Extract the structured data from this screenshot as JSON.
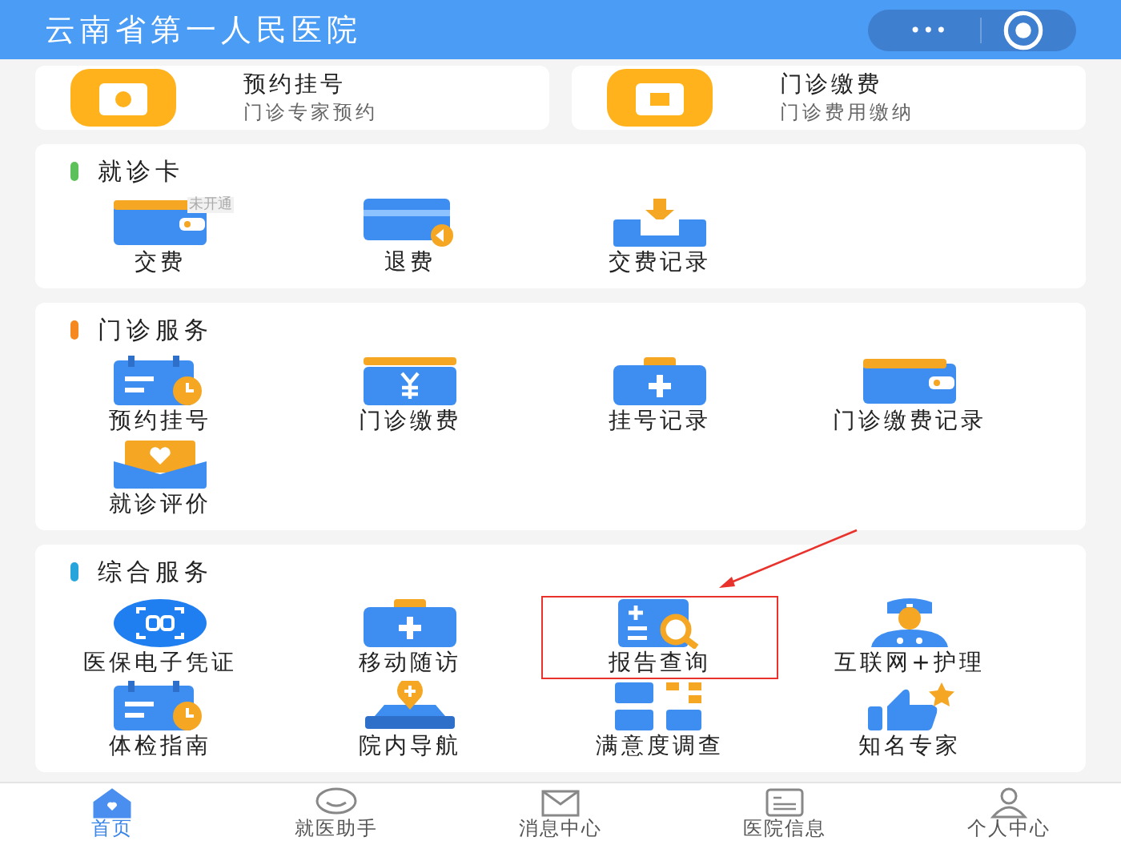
{
  "header": {
    "title": "云南省第一人民医院",
    "menu_dots": "•••"
  },
  "top_cards": [
    {
      "title": "预约挂号",
      "subtitle": "门诊专家预约"
    },
    {
      "title": "门诊缴费",
      "subtitle": "门诊费用缴纳"
    }
  ],
  "sections": [
    {
      "title": "就诊卡",
      "color": "#5cc15a",
      "items": [
        {
          "label": "交费",
          "badge": "未开通",
          "highlighted": false
        },
        {
          "label": "退费",
          "highlighted": false
        },
        {
          "label": "交费记录",
          "highlighted": false
        }
      ]
    },
    {
      "title": "门诊服务",
      "color": "#f5891f",
      "items": [
        {
          "label": "预约挂号",
          "highlighted": false
        },
        {
          "label": "门诊缴费",
          "highlighted": false
        },
        {
          "label": "挂号记录",
          "highlighted": false
        },
        {
          "label": "门诊缴费记录",
          "highlighted": false
        },
        {
          "label": "就诊评价",
          "highlighted": false
        }
      ]
    },
    {
      "title": "综合服务",
      "color": "#26a5dc",
      "items": [
        {
          "label": "医保电子凭证",
          "highlighted": false
        },
        {
          "label": "移动随访",
          "highlighted": false
        },
        {
          "label": "报告查询",
          "highlighted": true
        },
        {
          "label": "互联网+护理",
          "highlighted": false
        },
        {
          "label": "体检指南",
          "highlighted": false
        },
        {
          "label": "院内导航",
          "highlighted": false
        },
        {
          "label": "满意度调查",
          "highlighted": false
        },
        {
          "label": "知名专家",
          "highlighted": false
        }
      ]
    }
  ],
  "nav": [
    {
      "label": "首页",
      "selected": true
    },
    {
      "label": "就医助手",
      "selected": false
    },
    {
      "label": "消息中心",
      "selected": false
    },
    {
      "label": "医院信息",
      "selected": false
    },
    {
      "label": "个人中心",
      "selected": false
    }
  ]
}
